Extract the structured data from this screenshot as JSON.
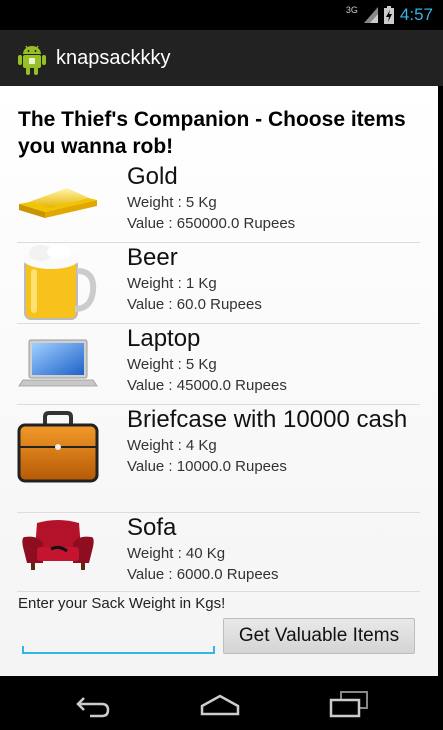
{
  "status_bar": {
    "network": "3G",
    "time": "4:57",
    "colors": {
      "time": "#33b5e5"
    }
  },
  "app_bar": {
    "title": "knapsackkky",
    "icon": "android-robot-icon"
  },
  "heading": "The Thief's Companion - Choose items you wanna rob!",
  "items": [
    {
      "name": "Gold",
      "weight": "Weight : 5 Kg",
      "value": "Value : 650000.0 Rupees",
      "icon": "gold-bar-icon"
    },
    {
      "name": "Beer",
      "weight": "Weight : 1 Kg",
      "value": "Value : 60.0 Rupees",
      "icon": "beer-mug-icon"
    },
    {
      "name": "Laptop",
      "weight": "Weight : 5 Kg",
      "value": "Value : 45000.0 Rupees",
      "icon": "laptop-icon"
    },
    {
      "name": "Briefcase with 10000 cash",
      "weight": "Weight : 4 Kg",
      "value": "Value : 10000.0 Rupees",
      "icon": "briefcase-icon"
    },
    {
      "name": "Sofa",
      "weight": "Weight : 40 Kg",
      "value": "Value : 6000.0 Rupees",
      "icon": "sofa-icon"
    }
  ],
  "sack": {
    "label": "Enter your Sack Weight in Kgs!",
    "input_value": "",
    "button_label": "Get Valuable Items"
  },
  "nav_bar": {
    "buttons": [
      "back-icon",
      "home-icon",
      "recent-apps-icon"
    ]
  }
}
